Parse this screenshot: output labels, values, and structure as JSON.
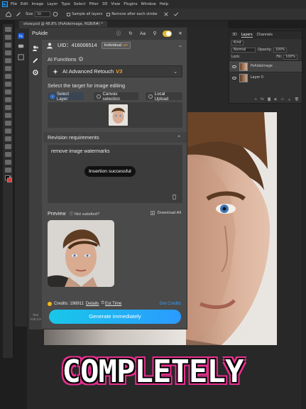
{
  "app": {
    "menu": [
      "File",
      "Edit",
      "Image",
      "Layer",
      "Type",
      "Select",
      "Filter",
      "3D",
      "View",
      "Plugins",
      "Window",
      "Help"
    ],
    "options": {
      "size_label": "Size",
      "size_value": "50",
      "sample_all_layers": "Sample all layers",
      "remove_after_stroke": "Remove after each stroke"
    },
    "doc_tab": "show.psd @ 48.8% (PsAideimage, RGB/8#) *"
  },
  "layers_panel": {
    "tabs": [
      "3D",
      "Layers",
      "Channels"
    ],
    "kind": "Kind",
    "blend_mode": "Normal",
    "opacity_label": "Opacity:",
    "opacity_value": "100%",
    "lock_label": "Lock:",
    "fill_label": "Fill:",
    "fill_value": "100%",
    "layers": [
      {
        "name": "PsAideimage",
        "selected": true
      },
      {
        "name": "Layer 0",
        "selected": false
      }
    ]
  },
  "plugin": {
    "title": "PsAide",
    "header_font_label": "Aa",
    "uid_label": "UID：416006514",
    "account_tag": "Individual",
    "account_sub": "VIP",
    "ai_functions_label": "AI Functions",
    "ai_function_selected": "AI Advanced Retouch",
    "ai_function_version": "V3",
    "target_label": "Select the target for image editing",
    "target_options": [
      {
        "label": "Select Layer",
        "selected": true
      },
      {
        "label": "Canvas selection",
        "selected": false
      },
      {
        "label": "Local Upload",
        "selected": false
      }
    ],
    "revision_label": "Revision requirements",
    "revision_text": "remove image watermarks",
    "toast": "Insertion successful",
    "preview_label": "Preview",
    "not_satisfied": "Not satisfied?",
    "download_all": "Download All",
    "credits_label": "Credits: 198911",
    "details_link": "Details",
    "est_time_link": "Est Time",
    "get_credits": "Get Credits",
    "generate_button": "Generate immediately",
    "side_text": "Test",
    "version": "V25.2.0"
  },
  "caption": "COMPLETELY",
  "colors": {
    "accent_blue": "#2a9bff",
    "toggle_yellow": "#e6b82e",
    "version_orange": "#f0a030",
    "caption_pink": "#e8308f"
  }
}
